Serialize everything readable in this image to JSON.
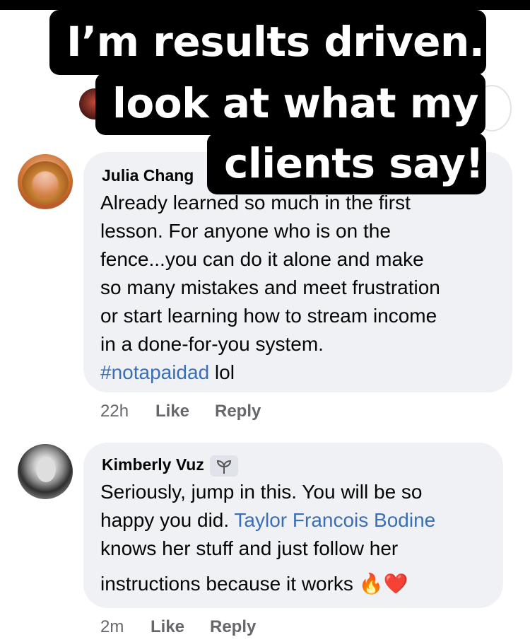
{
  "caption": {
    "line1": "I’m results driven..",
    "line2": "look at what my",
    "line3": "clients say!"
  },
  "comments": [
    {
      "author": "Julia Chang",
      "lines": [
        "Already learned so much in the first",
        "lesson. For anyone who is on the",
        "fence...you can do it alone and make",
        "so many mistakes and meet frustration",
        "or start learning how to stream income",
        "in a done-for-you system."
      ],
      "hashtag": "#notapaidad",
      "after_hashtag": " lol",
      "time": "22h",
      "like_label": "Like",
      "reply_label": "Reply"
    },
    {
      "author": "Kimberly Vuz",
      "badge_icon": "seedling-icon",
      "line1": "Seriously, jump in this. You will be so",
      "line2_prefix": "happy you did. ",
      "mention": "Taylor Francois Bodine",
      "line3": "knows her stuff and just follow her",
      "line4": "instructions because it works",
      "emojis": "🔥❤️",
      "time": "2m",
      "like_label": "Like",
      "reply_label": "Reply"
    }
  ],
  "colors": {
    "bubble": "#eff1f5",
    "link": "#3a6fb5",
    "meta": "#65676b",
    "caption_bg": "#000000",
    "caption_text": "#ffffff"
  }
}
